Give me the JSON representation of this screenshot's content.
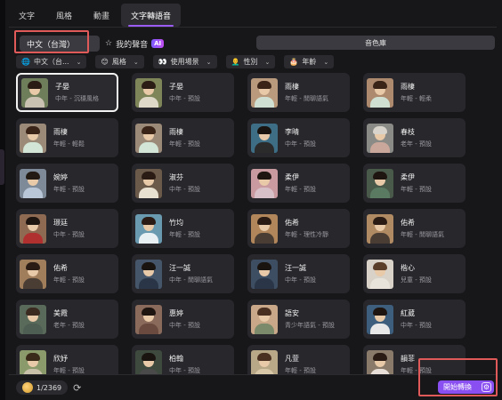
{
  "tabs": [
    {
      "label": "文字",
      "active": false
    },
    {
      "label": "風格",
      "active": false
    },
    {
      "label": "動畫",
      "active": false
    },
    {
      "label": "文字轉語音",
      "active": true
    }
  ],
  "subbar": {
    "language": "中文（台灣）",
    "my_voice": "我的聲音",
    "ai_badge": "AI",
    "library": "音色庫"
  },
  "filters": [
    {
      "icon": "globe-icon",
      "emoji": "🌐",
      "label": "中文（台..."
    },
    {
      "icon": "style-face-icon",
      "emoji": "😊",
      "label": "風格"
    },
    {
      "icon": "eyes-icon",
      "emoji": "👀",
      "label": "使用場景"
    },
    {
      "icon": "person-icon",
      "emoji": "👨‍🦲",
      "label": "性別"
    },
    {
      "icon": "cake-icon",
      "emoji": "🎂",
      "label": "年齡"
    }
  ],
  "voices": [
    {
      "name": "子晏",
      "desc": "中年 - 沉穩風格",
      "selected": true,
      "bg": "#6f7e5a",
      "hair": "#2b1d15",
      "shirt": "#c9c2b2"
    },
    {
      "name": "子晏",
      "desc": "中年 - 預設",
      "selected": false,
      "bg": "#7e8558",
      "hair": "#2b1d15",
      "shirt": "#ddd8c8"
    },
    {
      "name": "雨棲",
      "desc": "年輕 - 閒聊語氣",
      "selected": false,
      "bg": "#b99a7d",
      "hair": "#3a2418",
      "shirt": "#cfe0d3"
    },
    {
      "name": "雨棲",
      "desc": "年輕 - 輕柔",
      "selected": false,
      "bg": "#ad8a6e",
      "hair": "#3a2418",
      "shirt": "#cfe0d3"
    },
    {
      "name": "雨棲",
      "desc": "年輕 - 輕鬆",
      "selected": false,
      "bg": "#9c8a78",
      "hair": "#3a2418",
      "shirt": "#d2e5d6"
    },
    {
      "name": "雨棲",
      "desc": "年輕 - 預設",
      "selected": false,
      "bg": "#9c8a78",
      "hair": "#3a2418",
      "shirt": "#d2e5d6"
    },
    {
      "name": "李晴",
      "desc": "中年 - 預設",
      "selected": false,
      "bg": "#3d6e86",
      "hair": "#1a1410",
      "shirt": "#2b2b2b"
    },
    {
      "name": "春枝",
      "desc": "老年 - 預設",
      "selected": false,
      "bg": "#8a8a86",
      "hair": "#d8d4cc",
      "shirt": "#c9a79a"
    },
    {
      "name": "婉婷",
      "desc": "年輕 - 預設",
      "selected": false,
      "bg": "#7e8a98",
      "hair": "#241a14",
      "shirt": "#b9c6d8"
    },
    {
      "name": "淑芬",
      "desc": "中年 - 預設",
      "selected": false,
      "bg": "#6b5a4a",
      "hair": "#2a1c14",
      "shirt": "#e8e0d0"
    },
    {
      "name": "柔伊",
      "desc": "年輕 - 預設",
      "selected": false,
      "bg": "#c99aa0",
      "hair": "#1e1410",
      "shirt": "#d8c0c8"
    },
    {
      "name": "柔伊",
      "desc": "年輕 - 預設",
      "selected": false,
      "bg": "#4a5a4a",
      "hair": "#1e1410",
      "shirt": "#5a7a62"
    },
    {
      "name": "璟廷",
      "desc": "中年 - 預設",
      "selected": false,
      "bg": "#8f6a52",
      "hair": "#1e1410",
      "shirt": "#b03030"
    },
    {
      "name": "竹均",
      "desc": "年輕 - 預設",
      "selected": false,
      "bg": "#6a9ab0",
      "hair": "#2a1c14",
      "shirt": "#e8f0f4"
    },
    {
      "name": "佑希",
      "desc": "年輕 - 理性冷靜",
      "selected": false,
      "bg": "#b0865a",
      "hair": "#2a1c14",
      "shirt": "#4a3e34"
    },
    {
      "name": "佑希",
      "desc": "年輕 - 閒聊語氣",
      "selected": false,
      "bg": "#b08a62",
      "hair": "#2a1c14",
      "shirt": "#4a3e34"
    },
    {
      "name": "佑希",
      "desc": "年輕 - 預設",
      "selected": false,
      "bg": "#a07e5c",
      "hair": "#2a1c14",
      "shirt": "#4a3e34"
    },
    {
      "name": "汪一誠",
      "desc": "中年 - 閒聊語氣",
      "selected": false,
      "bg": "#46566a",
      "hair": "#1a1410",
      "shirt": "#2a3648"
    },
    {
      "name": "汪一誠",
      "desc": "中年 - 預設",
      "selected": false,
      "bg": "#3e4e62",
      "hair": "#1a1410",
      "shirt": "#2a3648"
    },
    {
      "name": "楷心",
      "desc": "兒童 - 預設",
      "selected": false,
      "bg": "#d8d2c8",
      "hair": "#5a3e2a",
      "shirt": "#e8e4dc"
    },
    {
      "name": "美霞",
      "desc": "老年 - 預設",
      "selected": false,
      "bg": "#5a6a5a",
      "hair": "#3a2a20",
      "shirt": "#4e5e52"
    },
    {
      "name": "惠婷",
      "desc": "中年 - 預設",
      "selected": false,
      "bg": "#8a6a5a",
      "hair": "#1e1410",
      "shirt": "#6a4a3e"
    },
    {
      "name": "語安",
      "desc": "青少年語氣 - 預設",
      "selected": false,
      "bg": "#c8a888",
      "hair": "#4a3020",
      "shirt": "#7a8a6a"
    },
    {
      "name": "紅葳",
      "desc": "中年 - 預設",
      "selected": false,
      "bg": "#3e5e7e",
      "hair": "#1e1410",
      "shirt": "#e8e8e8"
    },
    {
      "name": "欣妤",
      "desc": "年輕 - 預設",
      "selected": false,
      "bg": "#8a9a6a",
      "hair": "#3a2a1a",
      "shirt": "#c8c0a8"
    },
    {
      "name": "柏翰",
      "desc": "中年 - 預設",
      "selected": false,
      "bg": "#3e4a3e",
      "hair": "#1a1410",
      "shirt": "#4a4a4a"
    },
    {
      "name": "凡萱",
      "desc": "年輕 - 預設",
      "selected": false,
      "bg": "#b8a888",
      "hair": "#4a3020",
      "shirt": "#d8c8a8"
    },
    {
      "name": "韻菲",
      "desc": "年輕 - 預設",
      "selected": false,
      "bg": "#8a7a6a",
      "hair": "#2a1c14",
      "shirt": "#e8e0d8"
    }
  ],
  "footer": {
    "counter": "1/2369",
    "convert_label": "開始轉換"
  },
  "colors": {
    "accent": "#8a4ff0",
    "highlight_box": "#e05a5a",
    "card_bg": "#27272c",
    "panel_bg": "#17171a"
  }
}
